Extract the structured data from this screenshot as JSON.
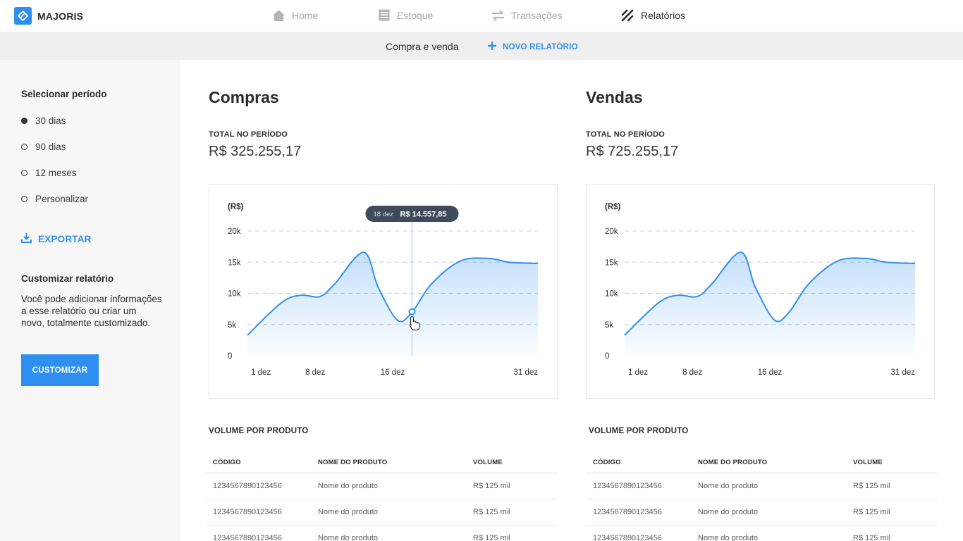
{
  "app": {
    "name": "MAJORIS",
    "accent": "#2e8ff0"
  },
  "nav": [
    {
      "label": "Home",
      "icon": "home-icon",
      "active": false
    },
    {
      "label": "Estoque",
      "icon": "list-icon",
      "active": false
    },
    {
      "label": "Transações",
      "icon": "transfer-icon",
      "active": false
    },
    {
      "label": "Relatórios",
      "icon": "reports-icon",
      "active": true
    }
  ],
  "subnav": {
    "tab": "Compra e venda",
    "new_report": "NOVO RELATÓRIO"
  },
  "sidebar": {
    "period_title": "Selecionar período",
    "periods": [
      {
        "label": "30 dias",
        "selected": true
      },
      {
        "label": "90 dias",
        "selected": false
      },
      {
        "label": "12 meses",
        "selected": false
      },
      {
        "label": "Personalizar",
        "selected": false
      }
    ],
    "export_label": "EXPORTAR",
    "custom_title": "Customizar relatório",
    "custom_desc": "Você pode adicionar informações a esse relatório ou criar um novo, totalmente customizado.",
    "custom_button": "CUSTOMIZAR"
  },
  "compras": {
    "title": "Compras",
    "total_label": "TOTAL NO PERÍODO",
    "total_value": "R$ 325.255,17",
    "volume_title": "VOLUME POR PRODUTO"
  },
  "vendas": {
    "title": "Vendas",
    "total_label": "TOTAL NO PERÍODO",
    "total_value": "R$ 725.255,17",
    "volume_title": "VOLUME POR PRODUTO"
  },
  "table": {
    "headers": [
      "CÓDIGO",
      "NOME DO PRODUTO",
      "VOLUME"
    ],
    "rows": [
      [
        "1234567890123456",
        "Nome do produto",
        "R$ 125 mil"
      ],
      [
        "1234567890123456",
        "Nome do produto",
        "R$ 125 mil"
      ],
      [
        "1234567890123456",
        "Nome do produto",
        "R$ 125 mil"
      ]
    ]
  },
  "chart_data": [
    {
      "type": "area",
      "ylabel": "(R$)",
      "ylim": [
        0,
        20000
      ],
      "yticks": [
        0,
        5000,
        10000,
        15000,
        20000
      ],
      "ytick_labels": [
        "0",
        "5k",
        "10k",
        "15k",
        "20k"
      ],
      "x_tick_labels": [
        "1 dez",
        "8 dez",
        "16 dez",
        "31 dez"
      ],
      "x_tick_days": [
        1,
        8,
        16,
        31
      ],
      "grid": true,
      "series": [
        {
          "x": [
            1,
            4.5,
            6.5,
            8.5,
            10,
            13,
            14.5,
            16.5,
            18,
            20,
            23,
            26,
            28,
            31
          ],
          "y": [
            3300,
            8500,
            9700,
            9500,
            11500,
            16600,
            11000,
            5700,
            7000,
            11500,
            15200,
            15600,
            15000,
            14800
          ]
        }
      ],
      "tooltip": {
        "x": 18,
        "date": "18 dez",
        "value": "R$ 14.557,85"
      }
    },
    {
      "type": "area",
      "ylabel": "(R$)",
      "ylim": [
        0,
        20000
      ],
      "yticks": [
        0,
        5000,
        10000,
        15000,
        20000
      ],
      "ytick_labels": [
        "0",
        "5k",
        "10k",
        "15k",
        "20k"
      ],
      "x_tick_labels": [
        "1 dez",
        "8 dez",
        "16 dez",
        "31 dez"
      ],
      "x_tick_days": [
        1,
        8,
        16,
        31
      ],
      "grid": true,
      "series": [
        {
          "x": [
            1,
            4.5,
            6.5,
            8.5,
            10,
            13,
            14.5,
            16.5,
            18,
            20,
            23,
            26,
            28,
            31
          ],
          "y": [
            3300,
            8500,
            9700,
            9500,
            11500,
            16600,
            11000,
            5700,
            7000,
            11500,
            15200,
            15600,
            15000,
            14800
          ]
        }
      ]
    }
  ]
}
